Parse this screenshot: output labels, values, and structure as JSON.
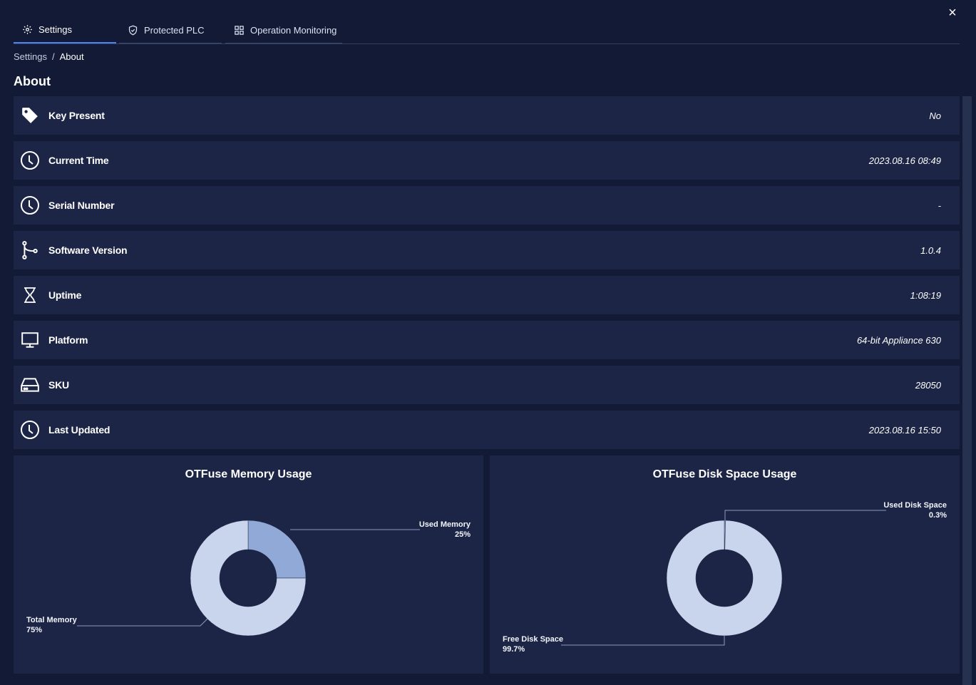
{
  "close_label": "×",
  "tabs": [
    {
      "label": "Settings",
      "icon": "gear-icon"
    },
    {
      "label": "Protected PLC",
      "icon": "shield-icon"
    },
    {
      "label": "Operation Monitoring",
      "icon": "grid-icon"
    }
  ],
  "breadcrumb": {
    "root": "Settings",
    "separator": "/",
    "current": "About"
  },
  "page_title": "About",
  "rows": [
    {
      "label": "Key Present",
      "value": "No",
      "icon": "tag-icon"
    },
    {
      "label": "Current Time",
      "value": "2023.08.16 08:49",
      "icon": "clock-icon"
    },
    {
      "label": "Serial Number",
      "value": "-",
      "icon": "clock-icon"
    },
    {
      "label": "Software Version",
      "value": "1.0.4",
      "icon": "branch-icon"
    },
    {
      "label": "Uptime",
      "value": "1:08:19",
      "icon": "hourglass-icon"
    },
    {
      "label": "Platform",
      "value": "64-bit Appliance 630",
      "icon": "monitor-icon"
    },
    {
      "label": "SKU",
      "value": "28050",
      "icon": "harddrive-icon"
    },
    {
      "label": "Last Updated",
      "value": "2023.08.16 15:50",
      "icon": "clock-icon"
    }
  ],
  "colors": {
    "background": "#131a36",
    "row": "#1c2545",
    "accent": "#4a80f0",
    "slice_used": "#91a9d6",
    "slice_free": "#c9d5ec"
  },
  "chart_data": [
    {
      "type": "pie",
      "title": "OTFuse Memory Usage",
      "slices": [
        {
          "name": "Used Memory",
          "percent_label": "25%",
          "value": 25
        },
        {
          "name": "Total Memory",
          "percent_label": "75%",
          "value": 75
        }
      ]
    },
    {
      "type": "pie",
      "title": "OTFuse Disk Space Usage",
      "slices": [
        {
          "name": "Used Disk Space",
          "percent_label": "0.3%",
          "value": 0.3
        },
        {
          "name": "Free Disk Space",
          "percent_label": "99.7%",
          "value": 99.7
        }
      ]
    }
  ]
}
